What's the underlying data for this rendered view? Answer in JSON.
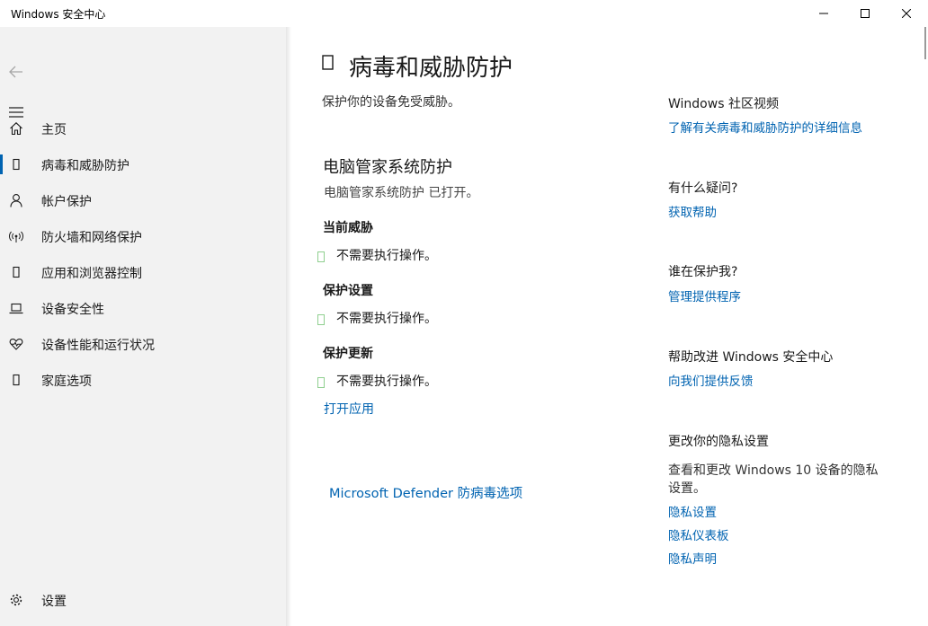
{
  "window": {
    "title": "Windows 安全中心"
  },
  "nav": {
    "items": [
      {
        "label": "主页",
        "icon": "home-icon"
      },
      {
        "label": "病毒和威胁防护",
        "icon": "shield-icon",
        "active": true
      },
      {
        "label": "帐户保护",
        "icon": "person-icon"
      },
      {
        "label": "防火墙和网络保护",
        "icon": "wifi-icon"
      },
      {
        "label": "应用和浏览器控制",
        "icon": "app-icon"
      },
      {
        "label": "设备安全性",
        "icon": "laptop-icon"
      },
      {
        "label": "设备性能和运行状况",
        "icon": "heart-icon"
      },
      {
        "label": "家庭选项",
        "icon": "family-icon"
      }
    ],
    "settings_label": "设置"
  },
  "main": {
    "page_title": "病毒和威胁防护",
    "subtitle": "保护你的设备免受威胁。",
    "provider_heading": "电脑管家系统防护",
    "provider_status": "电脑管家系统防护 已打开。",
    "sections": [
      {
        "heading": "当前威胁",
        "status": "不需要执行操作。"
      },
      {
        "heading": "保护设置",
        "status": "不需要执行操作。"
      },
      {
        "heading": "保护更新",
        "status": "不需要执行操作。"
      }
    ],
    "open_app_link": "打开应用",
    "defender_link": "Microsoft Defender 防病毒选项"
  },
  "aside": {
    "community": {
      "heading": "Windows 社区视频",
      "link": "了解有关病毒和威胁防护的详细信息"
    },
    "questions": {
      "heading": "有什么疑问?",
      "link": "获取帮助"
    },
    "protector": {
      "heading": "谁在保护我?",
      "link": "管理提供程序"
    },
    "feedback": {
      "heading": "帮助改进 Windows 安全中心",
      "link": "向我们提供反馈"
    },
    "privacy": {
      "heading": "更改你的隐私设置",
      "desc_line1": "查看和更改 Windows 10 设备的隐私",
      "desc_line2": "设置。",
      "links": [
        "隐私设置",
        "隐私仪表板",
        "隐私声明"
      ]
    }
  },
  "colors": {
    "accent": "#0063b1",
    "sidebar_bg": "#f2f2f2",
    "status_ok": "#107c10"
  }
}
